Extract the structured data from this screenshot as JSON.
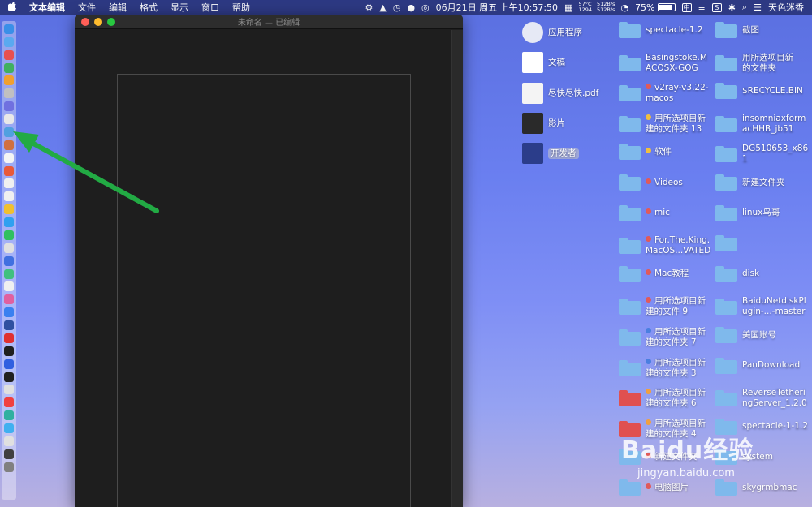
{
  "menubar": {
    "apple": "",
    "app_name": "文本编辑",
    "items": [
      "文件",
      "编辑",
      "格式",
      "显示",
      "窗口",
      "帮助"
    ],
    "net_up": "512B/s",
    "net_down": "512B/s",
    "temp": "57°C",
    "rpm": "1294",
    "datetime": "06月21日 周五 上午10:57:50",
    "battery": "75%",
    "input_method": "中",
    "user": "天色迷香"
  },
  "window": {
    "title": "未命名",
    "title_sep": "—",
    "status": "已编辑"
  },
  "desktop": {
    "col1": [
      {
        "label": "应用程序",
        "icon": "applications-icon"
      },
      {
        "label": "文稿",
        "icon": "documents-icon"
      },
      {
        "label": "尽快尽快.pdf",
        "icon": "pdf-icon"
      },
      {
        "label": "影片",
        "icon": "movies-icon"
      },
      {
        "label": "开发者",
        "icon": "developer-icon"
      }
    ],
    "col2": [
      {
        "line1": "spectacle-1.2",
        "line2": "",
        "tag": ""
      },
      {
        "line1": "Basingstoke.M",
        "line2": "ACOSX-GOG",
        "tag": ""
      },
      {
        "line1": "v2ray-v3.22-",
        "line2": "macos",
        "tag": "#e05a5a"
      },
      {
        "line1": "用所选项目新",
        "line2": "建的文件夹 13",
        "tag": "#f0c040"
      },
      {
        "line1": "软件",
        "line2": "",
        "tag": "#f0c040"
      },
      {
        "line1": "Videos",
        "line2": "",
        "tag": "#e05a5a"
      },
      {
        "line1": "mic",
        "line2": "",
        "tag": "#e05a5a"
      },
      {
        "line1": "For.The.King.",
        "line2": "MacOS...VATED",
        "tag": "#e05a5a"
      },
      {
        "line1": "Mac教程",
        "line2": "",
        "tag": "#e05a5a"
      },
      {
        "line1": "用所选项目新",
        "line2": "建的文件 9",
        "tag": "#e05a5a"
      },
      {
        "line1": "用所选项目新",
        "line2": "建的文件夹 7",
        "tag": "#4a7fe0"
      },
      {
        "line1": "用所选项目新",
        "line2": "建的文件夹 3",
        "tag": "#4a7fe0"
      },
      {
        "line1": "用所选项目新",
        "line2": "建的文件夹 6",
        "tag": "#f0a040"
      },
      {
        "line1": "用所选项目新",
        "line2": "建的文件夹 4",
        "tag": "#f0a040"
      },
      {
        "line1": "新建文件夹",
        "line2": "",
        "tag": "#e05a5a"
      },
      {
        "line1": "电脑图片",
        "line2": "",
        "tag": "#e05a5a"
      }
    ],
    "col3": [
      {
        "line1": "截图",
        "line2": ""
      },
      {
        "line1": "用所选项目新",
        "line2": "的文件夹"
      },
      {
        "line1": "$RECYCLE.BIN",
        "line2": ""
      },
      {
        "line1": "insomniaxform",
        "line2": "acHHB_jb51"
      },
      {
        "line1": "DG510653_x86",
        "line2": "1"
      },
      {
        "line1": "新建文件夹",
        "line2": ""
      },
      {
        "line1": "linux鸟哥",
        "line2": ""
      },
      {
        "line1": "",
        "line2": ""
      },
      {
        "line1": "disk",
        "line2": ""
      },
      {
        "line1": "BaiduNetdiskPl",
        "line2": "ugin-...-master"
      },
      {
        "line1": "美国账号",
        "line2": ""
      },
      {
        "line1": "PanDownload",
        "line2": ""
      },
      {
        "line1": "ReverseTetheri",
        "line2": "ngServer_1.2.0"
      },
      {
        "line1": "spectacle-1-1.2",
        "line2": ""
      },
      {
        "line1": "system",
        "line2": ""
      },
      {
        "line1": "skygrmbmac",
        "line2": ""
      }
    ]
  },
  "watermark": {
    "logo": "Baidu经验",
    "url": "jingyan.baidu.com"
  },
  "colors": {
    "folder": "#7fb9ec",
    "folder_red": "#e05050",
    "arrow": "#22aa44"
  }
}
